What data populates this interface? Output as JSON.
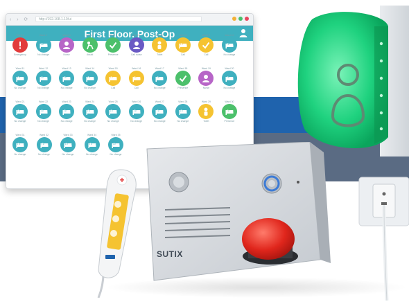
{
  "browser": {
    "url": "http://192.168.1.10/ui",
    "dots": [
      "#f2b136",
      "#46c06a",
      "#e8465e"
    ]
  },
  "dashboard": {
    "title": "First Floor. Post-Op",
    "rows": [
      [
        {
          "label": "Ward 1",
          "status": "Emergency",
          "color": "#e23b3b",
          "icon": "alert-icon"
        },
        {
          "label": "Ward 2",
          "status": "No change",
          "color": "#3fb0bf",
          "icon": "bed-icon"
        },
        {
          "label": "Ward 3",
          "status": "Nurse",
          "color": "#b765c7",
          "icon": "nurse-icon"
        },
        {
          "label": "Ward 4",
          "status": "Assist",
          "color": "#4cc06b",
          "icon": "assist-icon"
        },
        {
          "label": "Ward 5",
          "status": "Presence",
          "color": "#4cc06b",
          "icon": "check-icon"
        },
        {
          "label": "Ward 6",
          "status": "Call nurse",
          "color": "#6a5ac4",
          "icon": "nurse-icon"
        },
        {
          "label": "Ward 7",
          "status": "Toilet",
          "color": "#f5c331",
          "icon": "person-icon"
        },
        {
          "label": "Ward 8",
          "status": "Call",
          "color": "#f5c331",
          "icon": "bed-icon"
        },
        {
          "label": "Ward 9",
          "status": "Call",
          "color": "#f5c331",
          "icon": "check-icon"
        },
        {
          "label": "Ward 10",
          "status": "No change",
          "color": "#3fb0bf",
          "icon": "bed-icon"
        }
      ],
      [
        {
          "label": "Ward 11",
          "status": "No change",
          "color": "#3fb0bf",
          "icon": "bed-icon"
        },
        {
          "label": "Ward 12",
          "status": "No change",
          "color": "#3fb0bf",
          "icon": "bed-icon"
        },
        {
          "label": "Ward 13",
          "status": "No change",
          "color": "#3fb0bf",
          "icon": "bed-icon"
        },
        {
          "label": "Ward 14",
          "status": "No change",
          "color": "#3fb0bf",
          "icon": "bed-icon"
        },
        {
          "label": "Ward 15",
          "status": "Call",
          "color": "#f5c331",
          "icon": "bed-icon"
        },
        {
          "label": "Ward 16",
          "status": "Call",
          "color": "#f5c331",
          "icon": "bed-icon"
        },
        {
          "label": "Ward 17",
          "status": "No change",
          "color": "#3fb0bf",
          "icon": "bed-icon"
        },
        {
          "label": "Ward 18",
          "status": "Presence",
          "color": "#4cc06b",
          "icon": "check-icon"
        },
        {
          "label": "Ward 19",
          "status": "Nurse",
          "color": "#b765c7",
          "icon": "nurse-icon"
        },
        {
          "label": "Ward 20",
          "status": "No change",
          "color": "#3fb0bf",
          "icon": "bed-icon"
        }
      ],
      [
        {
          "label": "Ward 21",
          "status": "No change",
          "color": "#3fb0bf",
          "icon": "bed-icon"
        },
        {
          "label": "Ward 22",
          "status": "No change",
          "color": "#3fb0bf",
          "icon": "bed-icon"
        },
        {
          "label": "Ward 23",
          "status": "No change",
          "color": "#3fb0bf",
          "icon": "bed-icon"
        },
        {
          "label": "Ward 24",
          "status": "No change",
          "color": "#3fb0bf",
          "icon": "bed-icon"
        },
        {
          "label": "Ward 25",
          "status": "No change",
          "color": "#3fb0bf",
          "icon": "bed-icon"
        },
        {
          "label": "Ward 26",
          "status": "No change",
          "color": "#3fb0bf",
          "icon": "bed-icon"
        },
        {
          "label": "Ward 27",
          "status": "No change",
          "color": "#3fb0bf",
          "icon": "bed-icon"
        },
        {
          "label": "Ward 28",
          "status": "No change",
          "color": "#3fb0bf",
          "icon": "bed-icon"
        },
        {
          "label": "Ward 29",
          "status": "Toilet",
          "color": "#f5c331",
          "icon": "person-icon"
        },
        {
          "label": "Ward 30",
          "status": "Presence",
          "color": "#4cc06b",
          "icon": "bed-icon"
        }
      ],
      [
        {
          "label": "Ward 31",
          "status": "No change",
          "color": "#3fb0bf",
          "icon": "bed-icon"
        },
        {
          "label": "Ward 32",
          "status": "No change",
          "color": "#3fb0bf",
          "icon": "bed-icon"
        },
        {
          "label": "Ward 33",
          "status": "No change",
          "color": "#3fb0bf",
          "icon": "bed-icon"
        },
        {
          "label": "Ward 34",
          "status": "No change",
          "color": "#3fb0bf",
          "icon": "bed-icon"
        },
        {
          "label": "Ward 35",
          "status": "No change",
          "color": "#3fb0bf",
          "icon": "bed-icon"
        }
      ]
    ]
  },
  "device": {
    "brand": "SUTIX"
  }
}
